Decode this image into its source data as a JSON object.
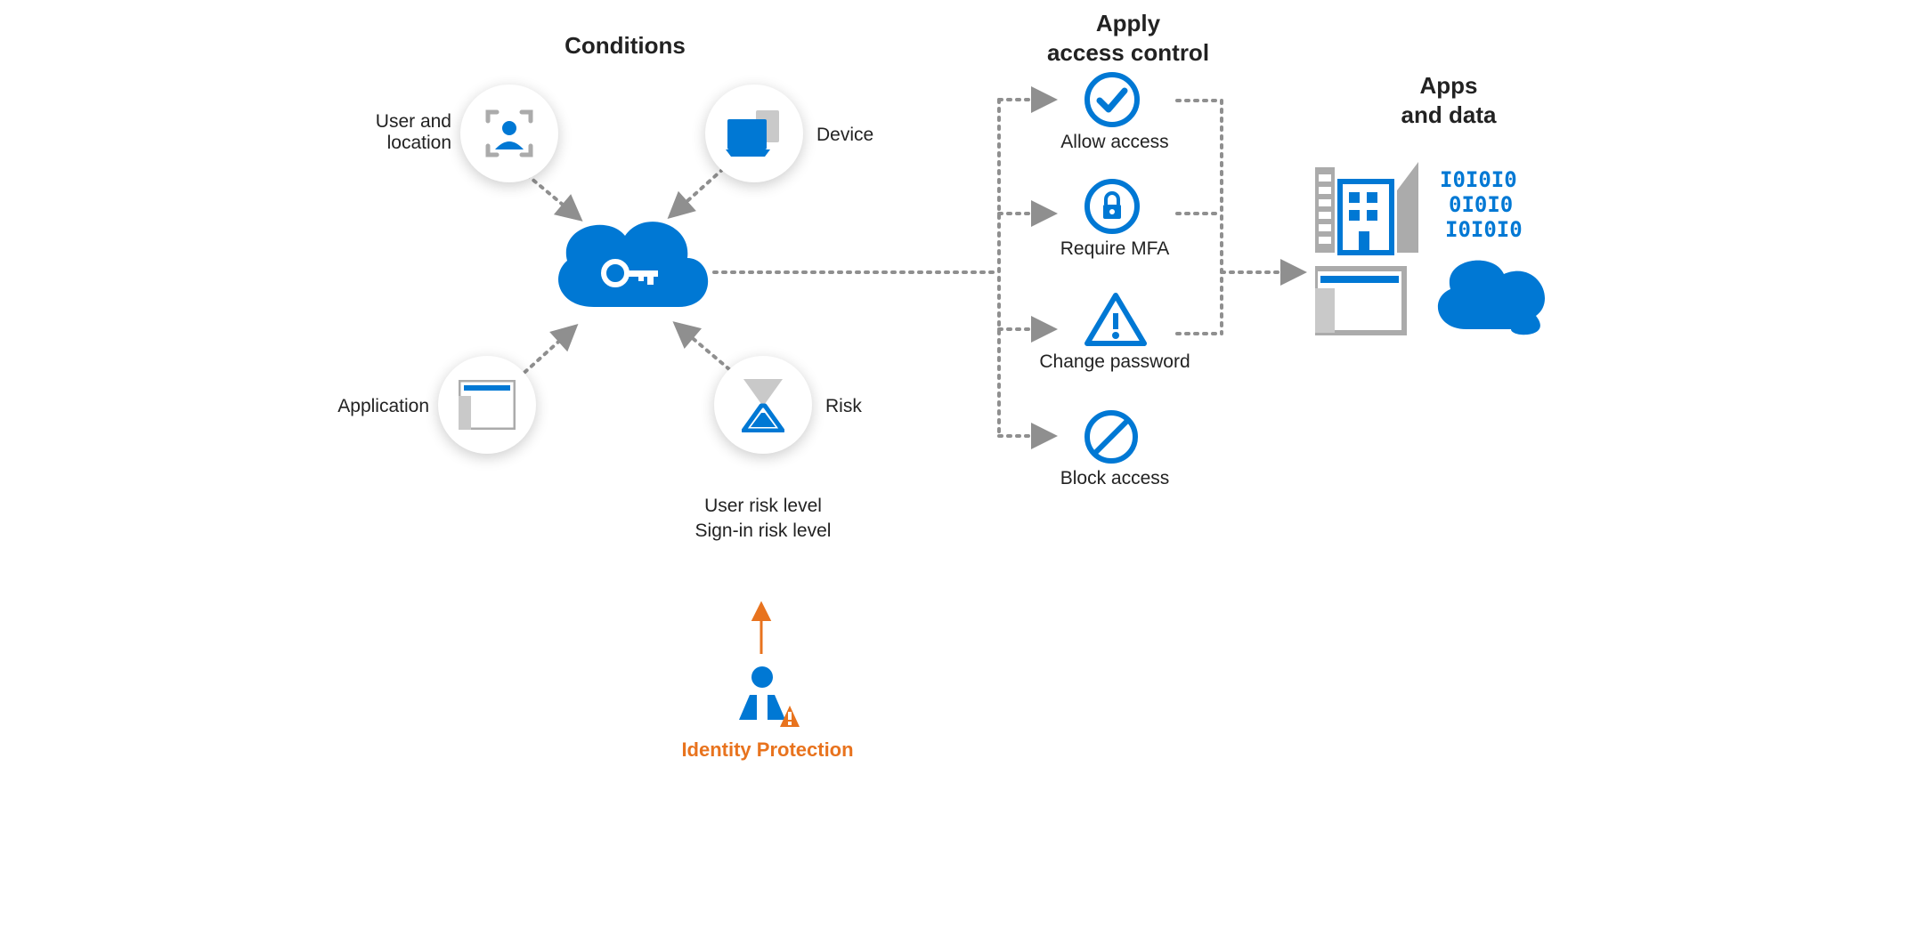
{
  "sections": {
    "conditions_title": "Conditions",
    "apply_title_line1": "Apply",
    "apply_title_line2": "access control",
    "apps_title_line1": "Apps",
    "apps_title_line2": "and data"
  },
  "conditions": {
    "user_location_l1": "User and",
    "user_location_l2": "location",
    "device": "Device",
    "application": "Application",
    "risk": "Risk",
    "risk_sub_l1": "User risk level",
    "risk_sub_l2": "Sign-in risk level"
  },
  "controls": {
    "allow": "Allow access",
    "mfa": "Require MFA",
    "change_pw": "Change password",
    "block": "Block access"
  },
  "identity_protection": "Identity Protection",
  "colors": {
    "blue": "#0078d4",
    "grey": "#8e8e8e",
    "arrow": "#8f8f8f",
    "orange": "#e8731e"
  }
}
